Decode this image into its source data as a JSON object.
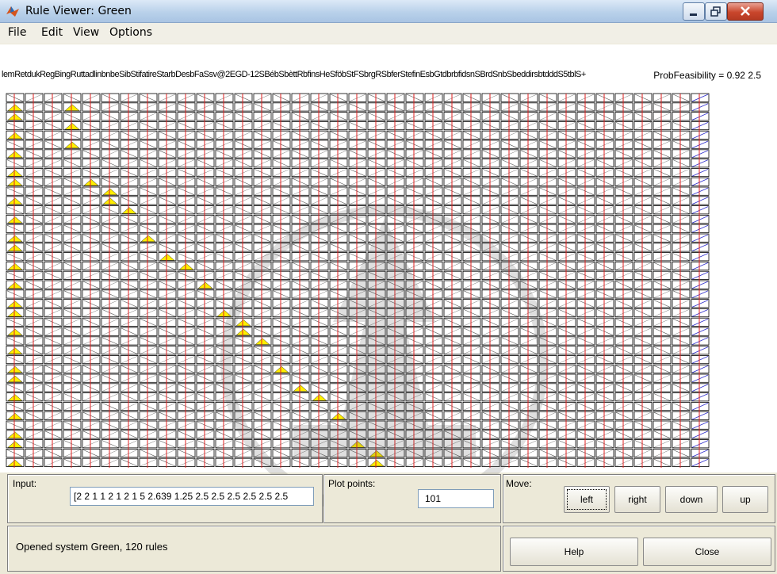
{
  "window": {
    "title": "Rule Viewer: Green"
  },
  "menu": [
    "File",
    "Edit",
    "View",
    "Options"
  ],
  "plot": {
    "header_left": "lemRetdukRegBingRuttadlinbnbeSibStifatireStarbDesbFaSsv@2EGD-12SBébSbèttRbfinsHeSföbStFSbrgRSbferStefinEsbGtdbrbfidsnSBrdSnbSbeddirsbtdddS5tblS+",
    "header_right": "= 0.92 2.5",
    "output_label": "ProbFeasibility"
  },
  "input_panel": {
    "label": "Input:",
    "value": "[2 2 1 1 2 1 2 1 5 2.639 1.25 2.5 2.5 2.5 2.5 2.5 2.5"
  },
  "plot_points_panel": {
    "label": "Plot points:",
    "value": "101"
  },
  "move_panel": {
    "label": "Move:",
    "buttons": [
      "left",
      "right",
      "down",
      "up"
    ]
  },
  "status": {
    "text": "Opened system Green, 120 rules"
  },
  "actions": {
    "help": "Help",
    "close": "Close"
  },
  "colors": {
    "rule_line": "#e02020",
    "membership": "#ffee00",
    "grid": "#000000"
  }
}
